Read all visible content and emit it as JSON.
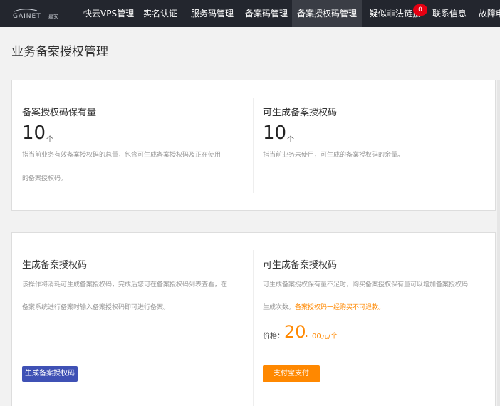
{
  "nav": {
    "logo_text": "GAINET 嘉安",
    "items": [
      {
        "label": "快云VPS管理"
      },
      {
        "label": "实名认证"
      },
      {
        "label": "服务码管理"
      },
      {
        "label": "备案码管理"
      },
      {
        "label": "备案授权码管理"
      },
      {
        "label": "疑似非法链接"
      },
      {
        "label": "联系信息"
      },
      {
        "label": "故障申"
      }
    ],
    "badge_count": "0"
  },
  "page_title": "业务备案授权管理",
  "stats": {
    "held": {
      "title": "备案授权码保有量",
      "value": "10",
      "unit": "个",
      "desc_line1": "指当前业务有效备案授权码的总量，包含可生成备案授权码及正在使用",
      "desc_line2": "的备案授权码。"
    },
    "available": {
      "title": "可生成备案授权码",
      "value": "10",
      "unit": "个",
      "desc": "指当前业务未使用，可生成的备案授权码的余量。"
    }
  },
  "generate": {
    "title": "生成备案授权码",
    "desc_line1": "该操作将消耗可生成备案授权码，完成后您可在备案授权码列表查看，在",
    "desc_line2": "备案系统进行备案时输入备案授权码即可进行备案。",
    "button_label": "生成备案授权码"
  },
  "purchase": {
    "title": "可生成备案授权码",
    "desc_line1": "可生成备案授权保有量不足时，购买备案授权保有量可以增加备案授权码",
    "desc_line2_prefix": "生成次数。",
    "desc_line2_warning": "备案授权码一经购买不可退款。",
    "price_label": "价格：",
    "price_value": "20",
    "price_decimal": ".",
    "price_unit": "00元/个",
    "button_label": "支付宝支付"
  },
  "colors": {
    "nav_bg": "#23262e",
    "accent_orange": "#ff8800",
    "button_blue": "#3f51b5",
    "badge_red": "#e60012"
  }
}
